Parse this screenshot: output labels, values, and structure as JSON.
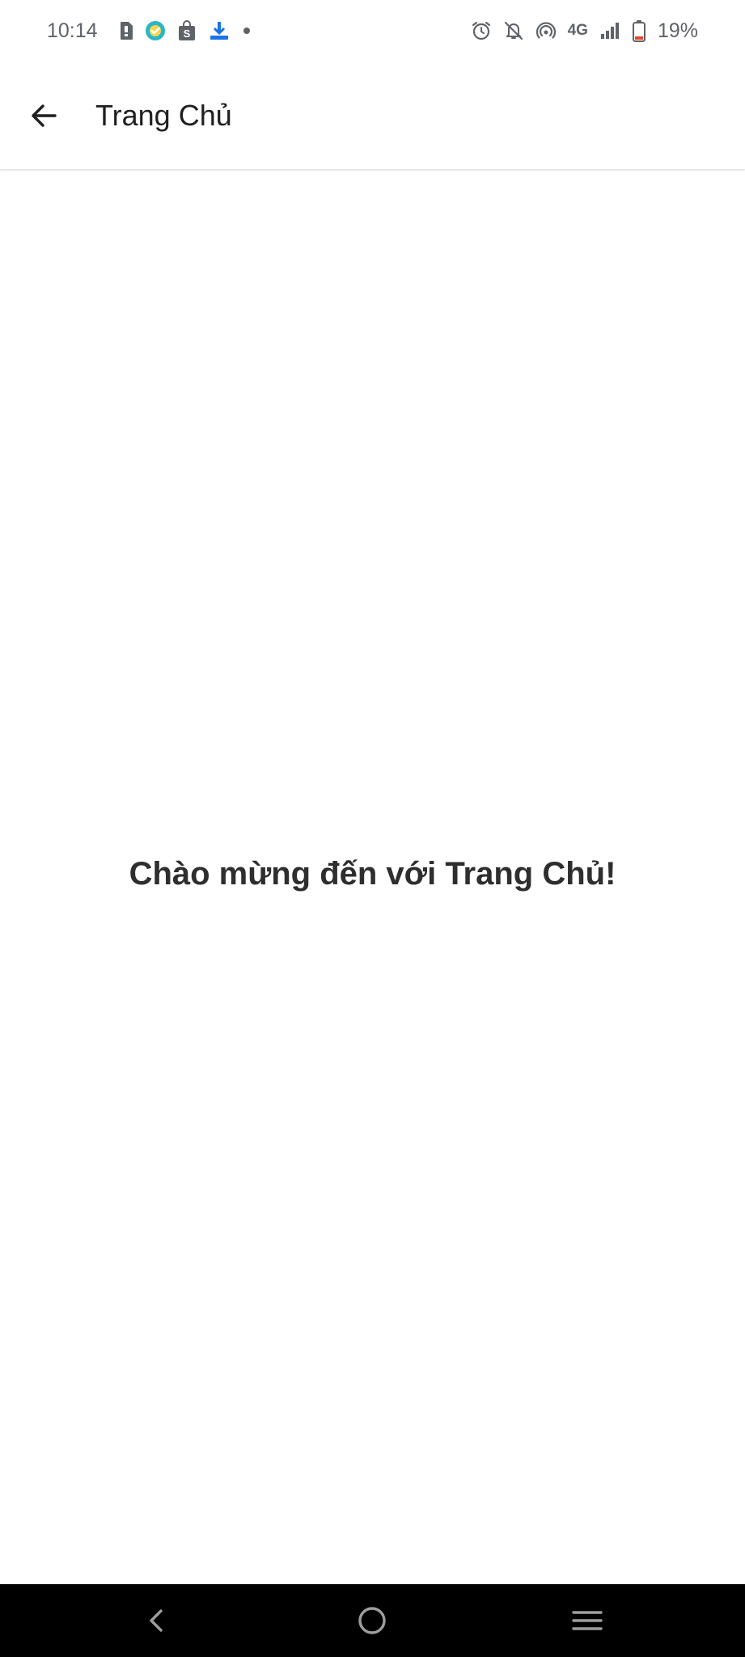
{
  "status_bar": {
    "time": "10:14",
    "network": "4G",
    "battery_percent": "19%",
    "left_icons": [
      "sim-card-icon",
      "check-badge-icon",
      "shopping-bag-icon",
      "download-icon",
      "dot-icon"
    ],
    "right_icons": [
      "alarm-icon",
      "notifications-off-icon",
      "hotspot-icon",
      "signal-icon",
      "battery-icon"
    ],
    "battery_level": 0.19,
    "battery_color": "#e8452c"
  },
  "app_bar": {
    "back_icon": "arrow-back-icon",
    "title": "Trang Chủ"
  },
  "main": {
    "welcome_text": "Chào mừng đến với Trang Chủ!"
  },
  "nav_bar": {
    "back_icon": "nav-back-icon",
    "home_icon": "nav-home-icon",
    "recents_icon": "nav-recents-icon"
  }
}
